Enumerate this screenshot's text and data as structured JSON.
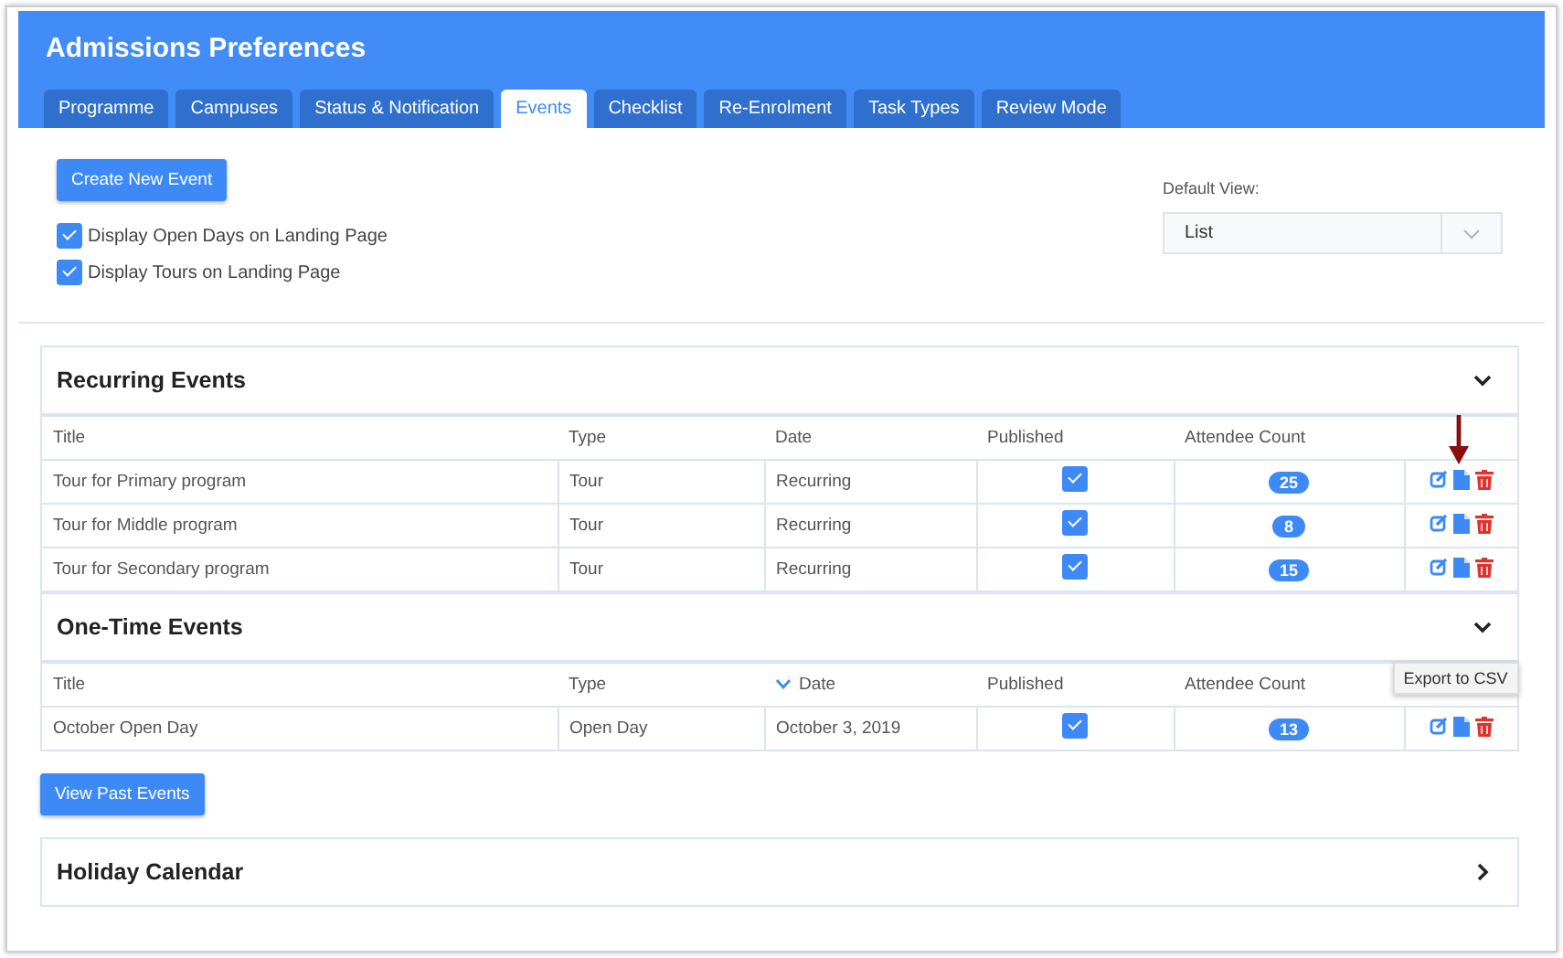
{
  "header": {
    "title": "Admissions Preferences"
  },
  "tabs": [
    {
      "label": "Programme",
      "selected": false
    },
    {
      "label": "Campuses",
      "selected": false
    },
    {
      "label": "Status & Notification",
      "selected": false
    },
    {
      "label": "Events",
      "selected": true
    },
    {
      "label": "Checklist",
      "selected": false
    },
    {
      "label": "Re-Enrolment",
      "selected": false
    },
    {
      "label": "Task Types",
      "selected": false
    },
    {
      "label": "Review Mode",
      "selected": false
    }
  ],
  "create_button": "Create New Event",
  "options": [
    {
      "label": "Display Open Days on Landing Page",
      "checked": true
    },
    {
      "label": "Display Tours on Landing Page",
      "checked": true
    }
  ],
  "default_view": {
    "label": "Default View:",
    "value": "List"
  },
  "sections": [
    {
      "title": "Recurring Events",
      "expanded": true,
      "columns": [
        {
          "label": "Title",
          "sorted": false
        },
        {
          "label": "Type",
          "sorted": false
        },
        {
          "label": "Date",
          "sorted": false
        },
        {
          "label": "Published",
          "sorted": false
        },
        {
          "label": "Attendee Count",
          "sorted": false
        }
      ],
      "rows": [
        {
          "title": "Tour for Primary program",
          "type": "Tour",
          "date": "Recurring",
          "published": true,
          "count": "25"
        },
        {
          "title": "Tour for Middle program",
          "type": "Tour",
          "date": "Recurring",
          "published": true,
          "count": "8"
        },
        {
          "title": "Tour for Secondary program",
          "type": "Tour",
          "date": "Recurring",
          "published": true,
          "count": "15"
        }
      ]
    },
    {
      "title": "One-Time Events",
      "expanded": true,
      "columns": [
        {
          "label": "Title",
          "sorted": false
        },
        {
          "label": "Type",
          "sorted": false
        },
        {
          "label": "Date",
          "sorted": true
        },
        {
          "label": "Published",
          "sorted": false
        },
        {
          "label": "Attendee Count",
          "sorted": false
        }
      ],
      "rows": [
        {
          "title": "October Open Day",
          "type": "Open Day",
          "date": "October 3, 2019",
          "published": true,
          "count": "13"
        }
      ],
      "button": "View Past Events"
    },
    {
      "title": "Holiday Calendar",
      "expanded": false
    }
  ],
  "tooltip": "Export to CSV"
}
